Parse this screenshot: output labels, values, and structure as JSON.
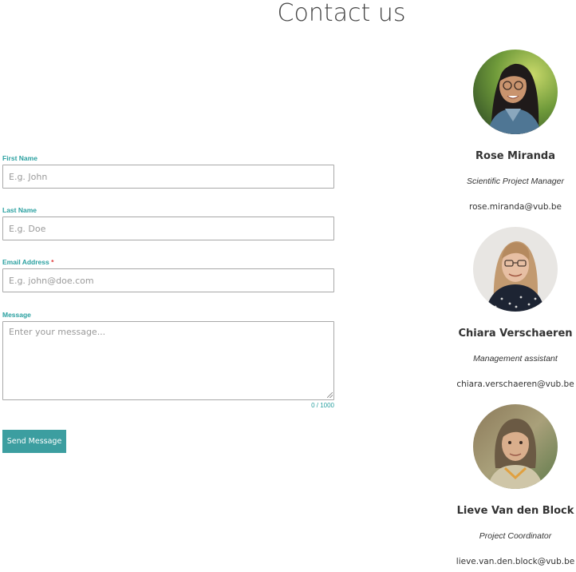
{
  "page": {
    "title": "Contact us"
  },
  "form": {
    "first_name": {
      "label": "First Name",
      "placeholder": "E.g. John",
      "value": ""
    },
    "last_name": {
      "label": "Last Name",
      "placeholder": "E.g. Doe",
      "value": ""
    },
    "email": {
      "label": "Email Address",
      "required_marker": "*",
      "placeholder": "E.g. john@doe.com",
      "value": ""
    },
    "message": {
      "label": "Message",
      "placeholder": "Enter your message...",
      "value": "",
      "counter": "0 / 1000"
    },
    "submit_label": "Send Message"
  },
  "contacts": [
    {
      "name": "Rose Miranda",
      "role": "Scientific Project Manager",
      "email": "rose.miranda@vub.be",
      "avatar_icon": "person-photo"
    },
    {
      "name": "Chiara Verschaeren",
      "role": "Management assistant",
      "email": "chiara.verschaeren@vub.be",
      "avatar_icon": "person-photo"
    },
    {
      "name": "Lieve Van den Block",
      "role": "Project Coordinator",
      "email": "lieve.van.den.block@vub.be",
      "avatar_icon": "person-photo"
    }
  ],
  "colors": {
    "accent": "#3c9ea0",
    "label": "#2aa0a0",
    "required": "#e03b3b",
    "input_border": "#a8a8a8"
  }
}
